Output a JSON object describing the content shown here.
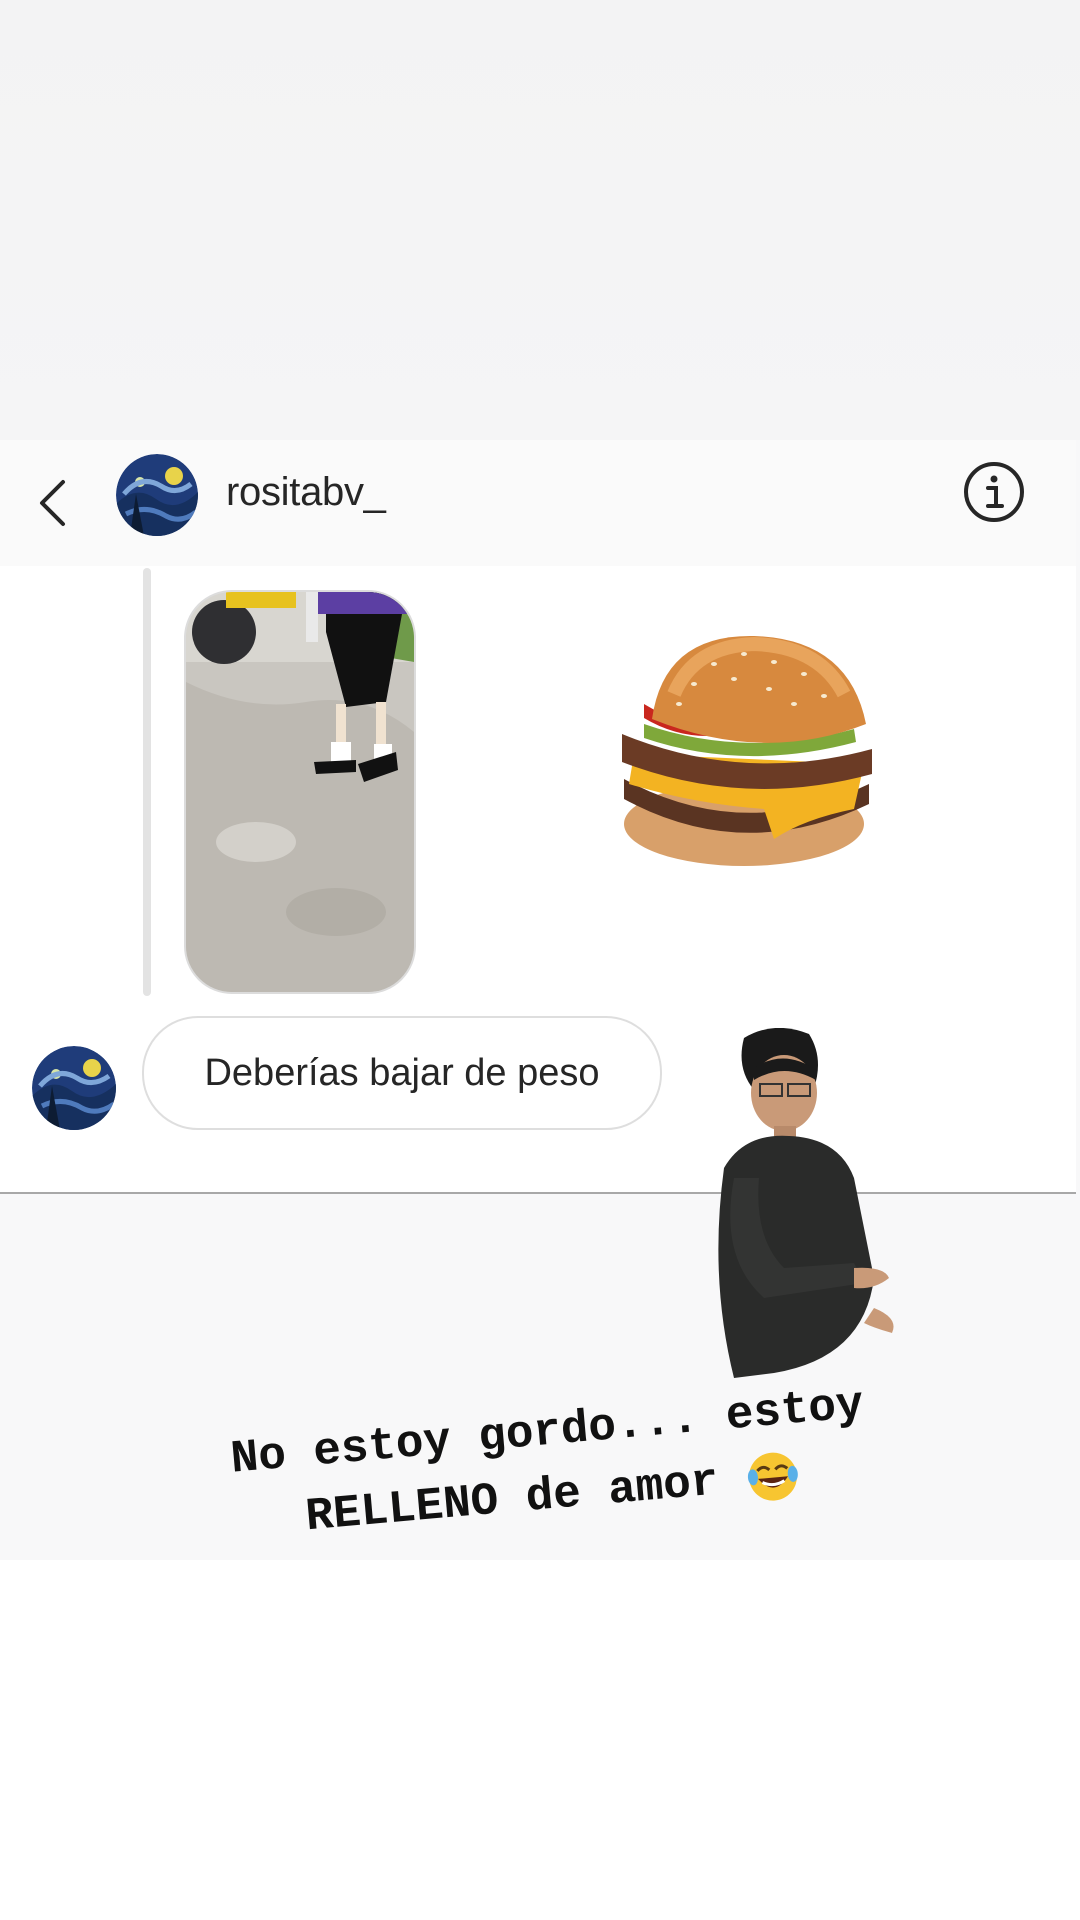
{
  "header": {
    "username": "rositabv_",
    "avatar_icon": "starry-night-avatar-icon",
    "back_icon": "chevron-left-icon",
    "info_icon": "info-circle-icon"
  },
  "chat": {
    "shared_photo_icon": "basketball-player-photo",
    "sticker_icon": "cheeseburger-sticker",
    "message_text": "Deberías bajar de peso",
    "sender_avatar_icon": "starry-night-avatar-icon"
  },
  "story": {
    "sticker_icon": "man-holding-belly-sticker",
    "caption_line1": "No estoy gordo... estoy",
    "caption_line2": "RELLENO de amor",
    "caption_emoji": "tears-of-joy-emoji"
  },
  "colors": {
    "text": "#262626",
    "divider": "#d4d4d4",
    "bubble_border": "#dedede"
  }
}
